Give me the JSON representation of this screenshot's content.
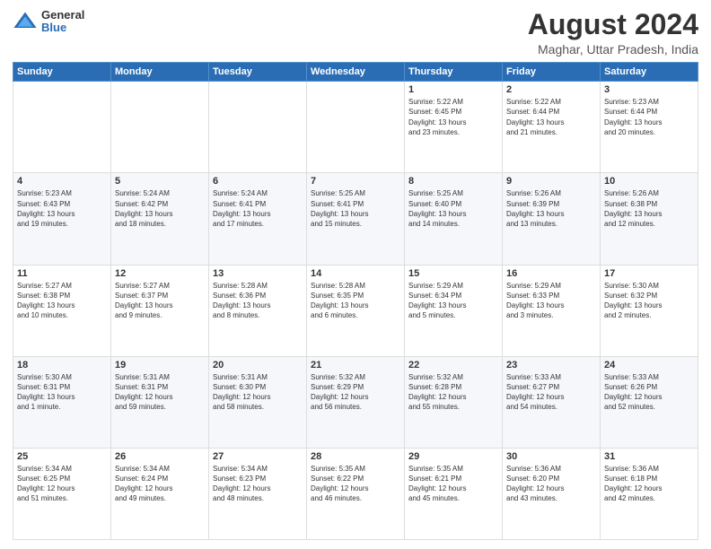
{
  "logo": {
    "general": "General",
    "blue": "Blue"
  },
  "title": "August 2024",
  "subtitle": "Maghar, Uttar Pradesh, India",
  "days_of_week": [
    "Sunday",
    "Monday",
    "Tuesday",
    "Wednesday",
    "Thursday",
    "Friday",
    "Saturday"
  ],
  "weeks": [
    [
      {
        "day": "",
        "info": ""
      },
      {
        "day": "",
        "info": ""
      },
      {
        "day": "",
        "info": ""
      },
      {
        "day": "",
        "info": ""
      },
      {
        "day": "1",
        "info": "Sunrise: 5:22 AM\nSunset: 6:45 PM\nDaylight: 13 hours\nand 23 minutes."
      },
      {
        "day": "2",
        "info": "Sunrise: 5:22 AM\nSunset: 6:44 PM\nDaylight: 13 hours\nand 21 minutes."
      },
      {
        "day": "3",
        "info": "Sunrise: 5:23 AM\nSunset: 6:44 PM\nDaylight: 13 hours\nand 20 minutes."
      }
    ],
    [
      {
        "day": "4",
        "info": "Sunrise: 5:23 AM\nSunset: 6:43 PM\nDaylight: 13 hours\nand 19 minutes."
      },
      {
        "day": "5",
        "info": "Sunrise: 5:24 AM\nSunset: 6:42 PM\nDaylight: 13 hours\nand 18 minutes."
      },
      {
        "day": "6",
        "info": "Sunrise: 5:24 AM\nSunset: 6:41 PM\nDaylight: 13 hours\nand 17 minutes."
      },
      {
        "day": "7",
        "info": "Sunrise: 5:25 AM\nSunset: 6:41 PM\nDaylight: 13 hours\nand 15 minutes."
      },
      {
        "day": "8",
        "info": "Sunrise: 5:25 AM\nSunset: 6:40 PM\nDaylight: 13 hours\nand 14 minutes."
      },
      {
        "day": "9",
        "info": "Sunrise: 5:26 AM\nSunset: 6:39 PM\nDaylight: 13 hours\nand 13 minutes."
      },
      {
        "day": "10",
        "info": "Sunrise: 5:26 AM\nSunset: 6:38 PM\nDaylight: 13 hours\nand 12 minutes."
      }
    ],
    [
      {
        "day": "11",
        "info": "Sunrise: 5:27 AM\nSunset: 6:38 PM\nDaylight: 13 hours\nand 10 minutes."
      },
      {
        "day": "12",
        "info": "Sunrise: 5:27 AM\nSunset: 6:37 PM\nDaylight: 13 hours\nand 9 minutes."
      },
      {
        "day": "13",
        "info": "Sunrise: 5:28 AM\nSunset: 6:36 PM\nDaylight: 13 hours\nand 8 minutes."
      },
      {
        "day": "14",
        "info": "Sunrise: 5:28 AM\nSunset: 6:35 PM\nDaylight: 13 hours\nand 6 minutes."
      },
      {
        "day": "15",
        "info": "Sunrise: 5:29 AM\nSunset: 6:34 PM\nDaylight: 13 hours\nand 5 minutes."
      },
      {
        "day": "16",
        "info": "Sunrise: 5:29 AM\nSunset: 6:33 PM\nDaylight: 13 hours\nand 3 minutes."
      },
      {
        "day": "17",
        "info": "Sunrise: 5:30 AM\nSunset: 6:32 PM\nDaylight: 13 hours\nand 2 minutes."
      }
    ],
    [
      {
        "day": "18",
        "info": "Sunrise: 5:30 AM\nSunset: 6:31 PM\nDaylight: 13 hours\nand 1 minute."
      },
      {
        "day": "19",
        "info": "Sunrise: 5:31 AM\nSunset: 6:31 PM\nDaylight: 12 hours\nand 59 minutes."
      },
      {
        "day": "20",
        "info": "Sunrise: 5:31 AM\nSunset: 6:30 PM\nDaylight: 12 hours\nand 58 minutes."
      },
      {
        "day": "21",
        "info": "Sunrise: 5:32 AM\nSunset: 6:29 PM\nDaylight: 12 hours\nand 56 minutes."
      },
      {
        "day": "22",
        "info": "Sunrise: 5:32 AM\nSunset: 6:28 PM\nDaylight: 12 hours\nand 55 minutes."
      },
      {
        "day": "23",
        "info": "Sunrise: 5:33 AM\nSunset: 6:27 PM\nDaylight: 12 hours\nand 54 minutes."
      },
      {
        "day": "24",
        "info": "Sunrise: 5:33 AM\nSunset: 6:26 PM\nDaylight: 12 hours\nand 52 minutes."
      }
    ],
    [
      {
        "day": "25",
        "info": "Sunrise: 5:34 AM\nSunset: 6:25 PM\nDaylight: 12 hours\nand 51 minutes."
      },
      {
        "day": "26",
        "info": "Sunrise: 5:34 AM\nSunset: 6:24 PM\nDaylight: 12 hours\nand 49 minutes."
      },
      {
        "day": "27",
        "info": "Sunrise: 5:34 AM\nSunset: 6:23 PM\nDaylight: 12 hours\nand 48 minutes."
      },
      {
        "day": "28",
        "info": "Sunrise: 5:35 AM\nSunset: 6:22 PM\nDaylight: 12 hours\nand 46 minutes."
      },
      {
        "day": "29",
        "info": "Sunrise: 5:35 AM\nSunset: 6:21 PM\nDaylight: 12 hours\nand 45 minutes."
      },
      {
        "day": "30",
        "info": "Sunrise: 5:36 AM\nSunset: 6:20 PM\nDaylight: 12 hours\nand 43 minutes."
      },
      {
        "day": "31",
        "info": "Sunrise: 5:36 AM\nSunset: 6:18 PM\nDaylight: 12 hours\nand 42 minutes."
      }
    ]
  ]
}
